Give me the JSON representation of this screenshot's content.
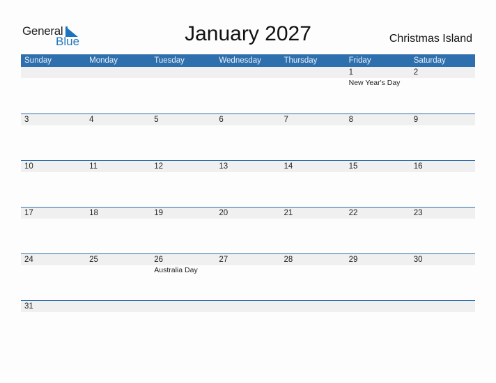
{
  "logo": {
    "line1": "General",
    "line2": "Blue"
  },
  "title": "January 2027",
  "country": "Christmas Island",
  "colors": {
    "header_bg": "#2e6fad",
    "band_bg": "#f0f0f0",
    "brand_blue": "#1e73be"
  },
  "weekdays": [
    "Sunday",
    "Monday",
    "Tuesday",
    "Wednesday",
    "Thursday",
    "Friday",
    "Saturday"
  ],
  "weeks": [
    [
      {
        "d": ""
      },
      {
        "d": ""
      },
      {
        "d": ""
      },
      {
        "d": ""
      },
      {
        "d": ""
      },
      {
        "d": "1",
        "h": "New Year's Day"
      },
      {
        "d": "2"
      }
    ],
    [
      {
        "d": "3"
      },
      {
        "d": "4"
      },
      {
        "d": "5"
      },
      {
        "d": "6"
      },
      {
        "d": "7"
      },
      {
        "d": "8"
      },
      {
        "d": "9"
      }
    ],
    [
      {
        "d": "10"
      },
      {
        "d": "11"
      },
      {
        "d": "12"
      },
      {
        "d": "13"
      },
      {
        "d": "14"
      },
      {
        "d": "15"
      },
      {
        "d": "16"
      }
    ],
    [
      {
        "d": "17"
      },
      {
        "d": "18"
      },
      {
        "d": "19"
      },
      {
        "d": "20"
      },
      {
        "d": "21"
      },
      {
        "d": "22"
      },
      {
        "d": "23"
      }
    ],
    [
      {
        "d": "24"
      },
      {
        "d": "25"
      },
      {
        "d": "26",
        "h": "Australia Day"
      },
      {
        "d": "27"
      },
      {
        "d": "28"
      },
      {
        "d": "29"
      },
      {
        "d": "30"
      }
    ],
    [
      {
        "d": "31"
      },
      {
        "d": ""
      },
      {
        "d": ""
      },
      {
        "d": ""
      },
      {
        "d": ""
      },
      {
        "d": ""
      },
      {
        "d": ""
      }
    ]
  ]
}
